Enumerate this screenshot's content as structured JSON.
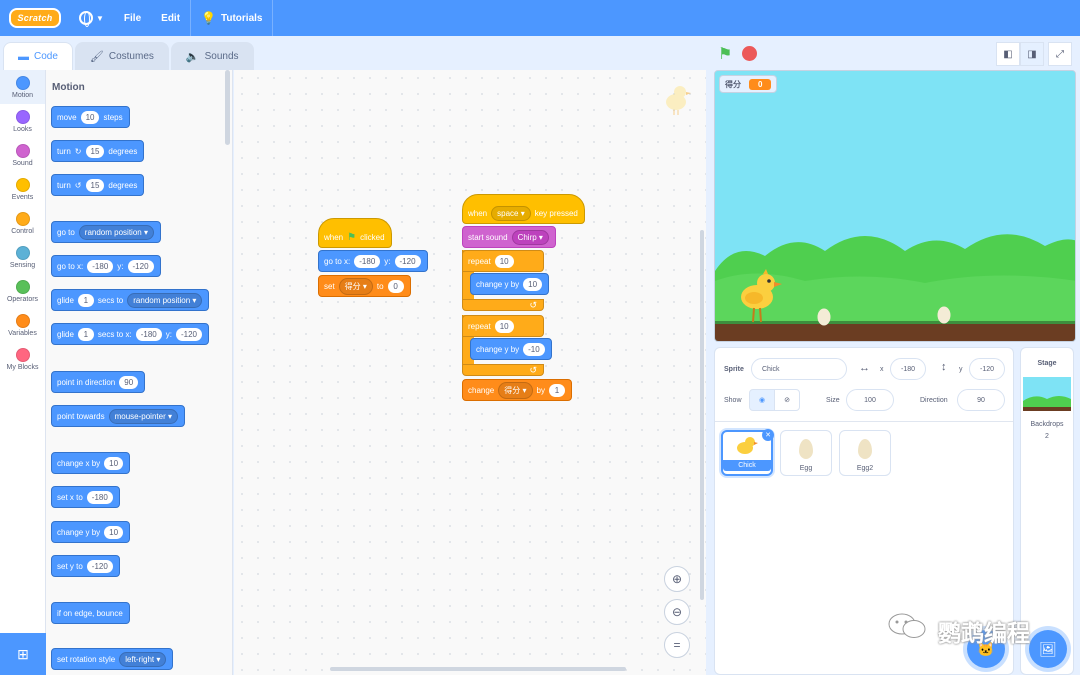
{
  "menubar": {
    "logo": "Scratch",
    "file": "File",
    "edit": "Edit",
    "tutorials": "Tutorials"
  },
  "tabs": {
    "code": "Code",
    "costumes": "Costumes",
    "sounds": "Sounds"
  },
  "categories": [
    {
      "label": "Motion",
      "color": "#4c97ff"
    },
    {
      "label": "Looks",
      "color": "#9966ff"
    },
    {
      "label": "Sound",
      "color": "#cf63cf"
    },
    {
      "label": "Events",
      "color": "#ffbf00"
    },
    {
      "label": "Control",
      "color": "#ffab19"
    },
    {
      "label": "Sensing",
      "color": "#5cb1d6"
    },
    {
      "label": "Operators",
      "color": "#59c059"
    },
    {
      "label": "Variables",
      "color": "#ff8c1a"
    },
    {
      "label": "My Blocks",
      "color": "#ff6680"
    }
  ],
  "palette": {
    "title": "Motion",
    "move": {
      "a": "move",
      "v": "10",
      "b": "steps"
    },
    "turn_right": {
      "a": "turn",
      "v": "15",
      "b": "degrees"
    },
    "turn_left": {
      "a": "turn",
      "v": "15",
      "b": "degrees"
    },
    "goto": {
      "a": "go to",
      "dd": "random position"
    },
    "goto_xy": {
      "a": "go to x:",
      "x": "-180",
      "b": "y:",
      "y": "-120"
    },
    "glide": {
      "a": "glide",
      "v": "1",
      "b": "secs to",
      "dd": "random position"
    },
    "glide_xy": {
      "a": "glide",
      "v": "1",
      "b": "secs to x:",
      "x": "-180",
      "c": "y:",
      "y": "-120"
    },
    "point_dir": {
      "a": "point in direction",
      "v": "90"
    },
    "point_towards": {
      "a": "point towards",
      "dd": "mouse-pointer"
    },
    "change_x": {
      "a": "change x by",
      "v": "10"
    },
    "set_x": {
      "a": "set x to",
      "v": "-180"
    },
    "change_y": {
      "a": "change y by",
      "v": "10"
    },
    "set_y": {
      "a": "set y to",
      "v": "-120"
    },
    "bounce": "if on edge, bounce",
    "rot_style": {
      "a": "set rotation style",
      "dd": "left-right"
    }
  },
  "script1": {
    "hat_a": "when",
    "hat_b": "clicked",
    "goto_a": "go to x:",
    "goto_x": "-180",
    "goto_b": "y:",
    "goto_y": "-120",
    "set_a": "set",
    "set_var": "得分",
    "set_b": "to",
    "set_v": "0"
  },
  "script2": {
    "hat_a": "when",
    "hat_key": "space",
    "hat_b": "key pressed",
    "sound_a": "start sound",
    "sound_dd": "Chirp",
    "rep1_a": "repeat",
    "rep1_v": "10",
    "cy1_a": "change y by",
    "cy1_v": "10",
    "rep2_a": "repeat",
    "rep2_v": "10",
    "cy2_a": "change y by",
    "cy2_v": "-10",
    "chg_a": "change",
    "chg_var": "得分",
    "chg_b": "by",
    "chg_v": "1"
  },
  "stage": {
    "var_label": "得分",
    "var_value": "0"
  },
  "sprite_info": {
    "sprite_label": "Sprite",
    "sprite_name": "Chick",
    "x_label": "x",
    "x": "-180",
    "y_label": "y",
    "y": "-120",
    "show_label": "Show",
    "size_label": "Size",
    "size": "100",
    "dir_label": "Direction",
    "direction": "90"
  },
  "sprites": [
    {
      "name": "Chick"
    },
    {
      "name": "Egg"
    },
    {
      "name": "Egg2"
    }
  ],
  "stage_pane": {
    "title": "Stage",
    "backdrops": "Backdrops",
    "count": "2"
  },
  "watermark": "鹦鹉编程"
}
